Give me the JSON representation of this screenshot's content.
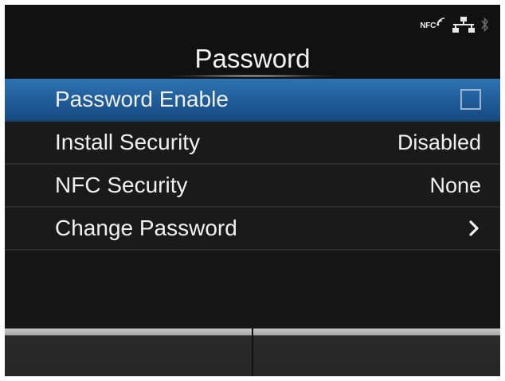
{
  "status_icons": {
    "nfc_label": "NFC",
    "nfc_icon": "nfc-icon",
    "network_icon": "network-icon",
    "bluetooth_icon": "bluetooth-icon"
  },
  "header": {
    "title": "Password"
  },
  "menu": {
    "items": [
      {
        "label": "Password Enable",
        "control": "checkbox",
        "checked": false,
        "selected": true
      },
      {
        "label": "Install Security",
        "value": "Disabled"
      },
      {
        "label": "NFC Security",
        "value": "None"
      },
      {
        "label": "Change Password",
        "control": "chevron-right-icon"
      }
    ]
  },
  "softkeys": {
    "left_label": "",
    "right_label": ""
  },
  "colors": {
    "screen_background": "#111111",
    "selection_accent": "#2269a8",
    "text": "#f0f0f0"
  }
}
